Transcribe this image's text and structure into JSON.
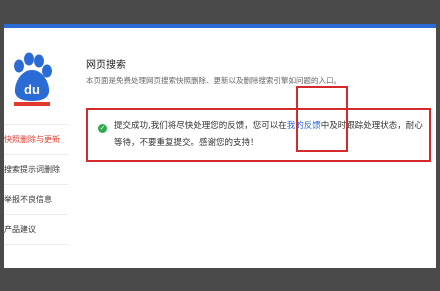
{
  "brand": {
    "logo_text": "du",
    "colors": {
      "logo_blue": "#2b6bd6",
      "logo_red": "#e0392b",
      "accent": "#2b6bd6",
      "alert_red": "#d42a2a",
      "success": "#2eaa4a"
    }
  },
  "sidebar": {
    "items": [
      {
        "label": "快照删除与更新",
        "active": true
      },
      {
        "label": "搜索提示词删除",
        "active": false
      },
      {
        "label": "举报不良信息",
        "active": false
      },
      {
        "label": "产品建议",
        "active": false
      }
    ]
  },
  "main": {
    "title": "网页搜索",
    "description": "本页面是免费处理网页搜索快照删除、更新以及删除搜索引擎如问题的入口。"
  },
  "message": {
    "icon": "check-circle-icon",
    "text_before": "提交成功,我们将尽快处理您的反馈，您可以在",
    "link": "我的反馈",
    "text_after": "中及时跟踪处理状态，耐心等待，不要重复提交。感谢您的支持！"
  }
}
